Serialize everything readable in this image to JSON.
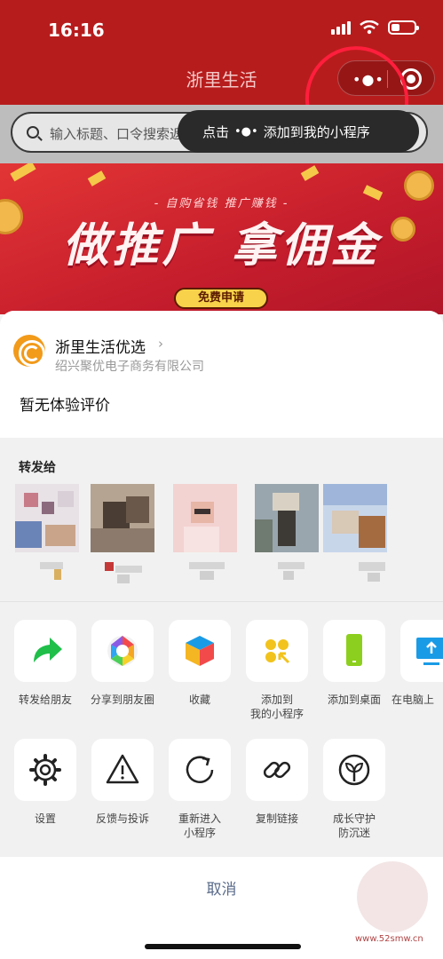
{
  "status_bar": {
    "time": "16:16"
  },
  "header": {
    "title": "浙里生活",
    "capsule_dots": "•●•",
    "tip_text_prefix": "点击",
    "tip_dots": "•●•",
    "tip_text_suffix": "添加到我的小程序"
  },
  "search": {
    "placeholder": "输入标题、口令搜索返利"
  },
  "banner": {
    "subtitle": "- 自购省钱 推广赚钱 -",
    "title": "做推广 拿佣金",
    "button": "免费申请"
  },
  "sheet": {
    "app_name": "浙里生活优选",
    "company": "绍兴聚优电子商务有限公司",
    "review": "暂无体验评价",
    "share_title": "转发给",
    "actions_row1": [
      {
        "label": "转发给朋友",
        "icon": "share-arrow-icon"
      },
      {
        "label": "分享到朋友圈",
        "icon": "moments-icon"
      },
      {
        "label": "收藏",
        "icon": "favorite-cube-icon"
      },
      {
        "label": "添加到\n我的小程序",
        "icon": "add-miniprogram-icon"
      },
      {
        "label": "添加到桌面",
        "icon": "add-to-desktop-icon"
      },
      {
        "label": "在电脑上",
        "icon": "open-on-pc-icon"
      }
    ],
    "actions_row2": [
      {
        "label": "设置",
        "icon": "gear-icon"
      },
      {
        "label": "反馈与投诉",
        "icon": "warning-icon"
      },
      {
        "label": "重新进入\n小程序",
        "icon": "reload-icon"
      },
      {
        "label": "复制链接",
        "icon": "link-icon"
      },
      {
        "label": "成长守护\n防沉迷",
        "icon": "sprout-icon"
      }
    ],
    "cancel": "取消"
  },
  "colors": {
    "header_red": "#b71c1c",
    "green": "#1fbf4a",
    "yellow": "#f2c31c",
    "blue": "#1a9be6",
    "cancel_blue": "#5a6b8a"
  },
  "watermark": "www.52smw.cn"
}
